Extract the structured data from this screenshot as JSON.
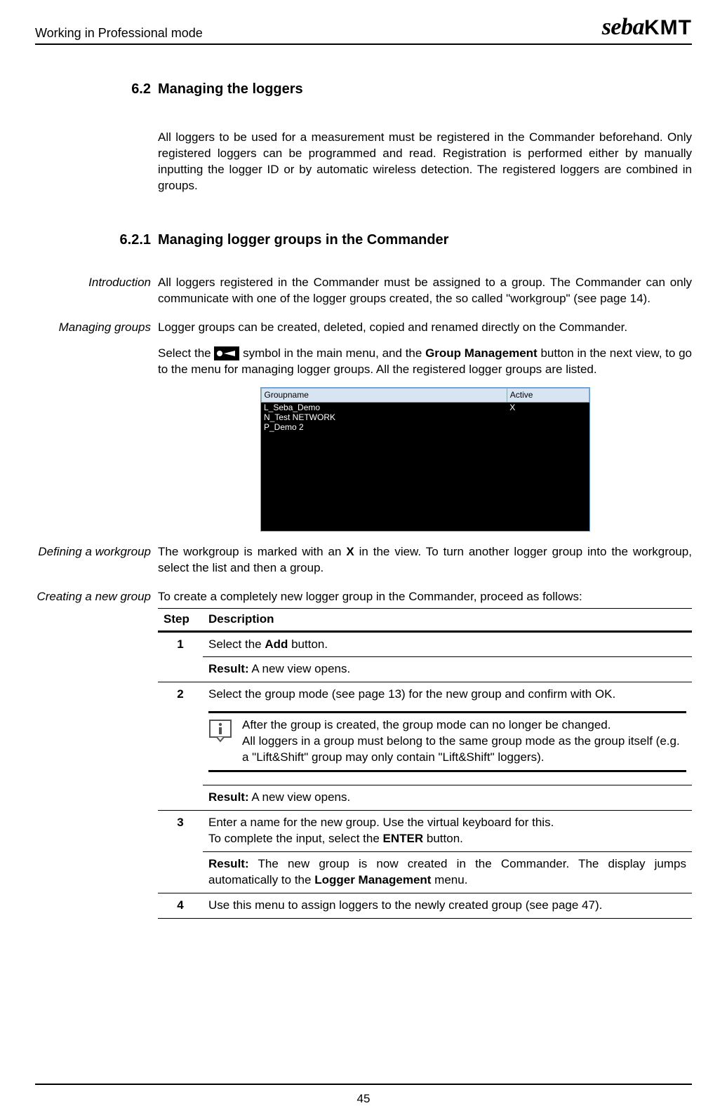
{
  "header": {
    "left": "Working in Professional mode",
    "logo_seba": "seba",
    "logo_kmt": "KMT"
  },
  "section62": {
    "number": "6.2",
    "title": "Managing the loggers",
    "intro": "All loggers to be used for a measurement must be registered in the Commander beforehand. Only registered loggers can be programmed and read. Registration is performed either by manually inputting the logger ID or by automatic wireless detection. The registered loggers are combined in groups."
  },
  "section621": {
    "number": "6.2.1",
    "title": "Managing logger groups in the Commander",
    "intro_label": "Introduction",
    "intro_text": "All loggers registered in the Commander must be assigned to a group. The Commander can only communicate with one of the logger groups created, the so called \"workgroup\" (see page 14).",
    "groups_label": "Managing groups",
    "groups_text1": "Logger groups can be created, deleted, copied and renamed directly on the Commander.",
    "groups_text2a": "Select the ",
    "groups_text2b": " symbol in the main menu, and the ",
    "groups_bold1": "Group Management",
    "groups_text2c": " button in the next view, to go to the menu for managing logger groups. All the registered logger groups are listed.",
    "workgroup_label": "Defining a workgroup",
    "workgroup_text_a": "The workgroup is marked with an ",
    "workgroup_bold": "X",
    "workgroup_text_b": " in the view. To turn another logger group into the workgroup, select the list and then a group.",
    "create_label": "Creating a new group",
    "create_intro": "To create a completely new logger group in the Commander, proceed as follows:"
  },
  "screenshot": {
    "col1": "Groupname",
    "col2": "Active",
    "rows": [
      {
        "name": "L_Seba_Demo",
        "active": "X"
      },
      {
        "name": "N_Test NETWORK",
        "active": ""
      },
      {
        "name": "P_Demo 2",
        "active": ""
      }
    ]
  },
  "steps_header": {
    "step": "Step",
    "desc": "Description"
  },
  "steps": {
    "s1": {
      "num": "1",
      "action_a": "Select the ",
      "action_bold": "Add",
      "action_b": " button.",
      "result_label": "Result:",
      "result": " A new view opens."
    },
    "s2": {
      "num": "2",
      "action": "Select the group mode (see page 13) for the new group and confirm with OK.",
      "note1": "After the group is created, the group mode can no longer be changed.",
      "note2": "All loggers in a group must belong to the same group mode as the group itself (e.g. a \"Lift&Shift\" group may only contain \"Lift&Shift\" loggers).",
      "result_label": "Result:",
      "result": " A new view opens."
    },
    "s3": {
      "num": "3",
      "line1": "Enter a name for the new group. Use the virtual keyboard for this.",
      "line2a": "To complete the input, select the ",
      "line2_bold": "ENTER",
      "line2b": " button.",
      "result_label": "Result:",
      "result_a": " The new group is now created in the Commander. The display jumps automatically to the ",
      "result_bold": "Logger Management",
      "result_b": " menu."
    },
    "s4": {
      "num": "4",
      "action": "Use this menu to assign loggers to the newly created group (see page 47)."
    }
  },
  "footer": {
    "page": "45"
  }
}
